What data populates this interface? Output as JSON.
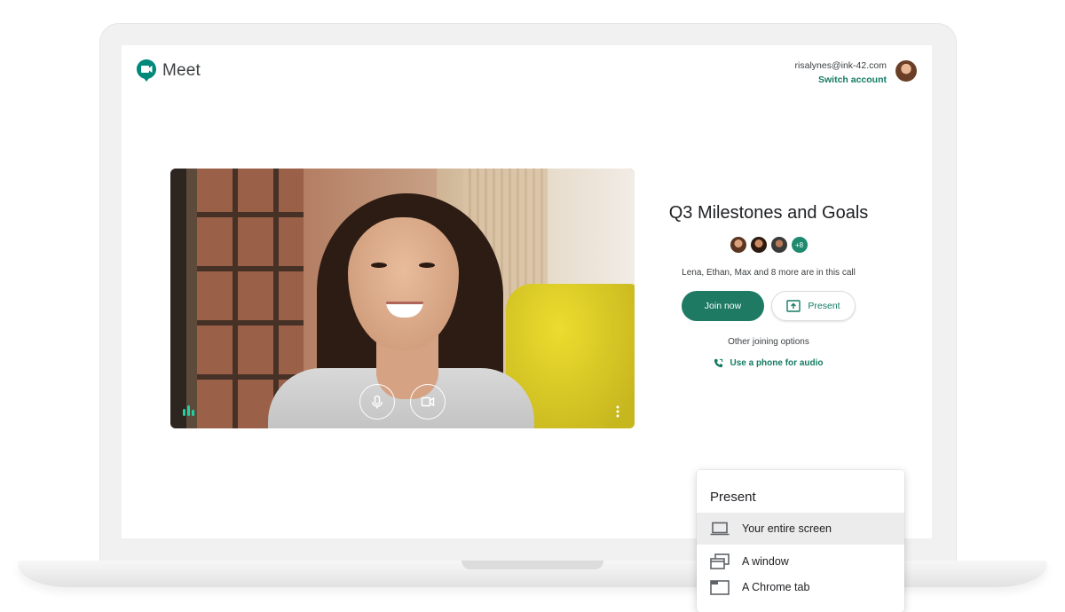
{
  "app": {
    "name": "Meet"
  },
  "account": {
    "email": "risalynes@ink-42.com",
    "switch_label": "Switch account"
  },
  "meeting": {
    "title": "Q3 Milestones and Goals",
    "extra_participants": "+8",
    "in_call_text": "Lena, Ethan, Max and 8 more are in this call",
    "join_label": "Join now",
    "present_label": "Present",
    "other_options_label": "Other joining options",
    "phone_audio_label": "Use a phone for audio"
  },
  "video_controls": {
    "mic_icon": "mic-icon",
    "camera_icon": "camera-icon",
    "more_icon": "more-vert-icon",
    "level_icon": "audio-level-icon"
  },
  "present_menu": {
    "title": "Present",
    "items": [
      {
        "label": "Your entire screen",
        "icon": "laptop-icon",
        "selected": true
      },
      {
        "label": "A window",
        "icon": "window-icon",
        "selected": false
      },
      {
        "label": "A Chrome tab",
        "icon": "tab-icon",
        "selected": false
      }
    ]
  },
  "colors": {
    "accent": "#1e7a63",
    "link": "#137b63",
    "text": "#3c4043"
  }
}
